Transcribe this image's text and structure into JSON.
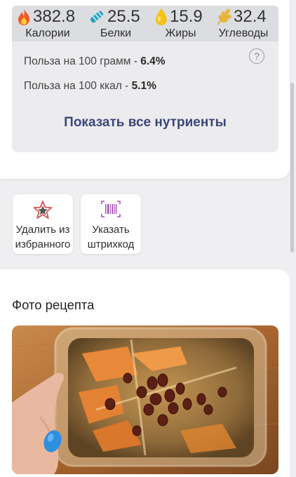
{
  "macros": [
    {
      "value": "382.8",
      "label": "Калории",
      "icon": "flame-icon",
      "color": "#f15a24"
    },
    {
      "value": "25.5",
      "label": "Белки",
      "icon": "protein-icon",
      "color": "#1e9fc1"
    },
    {
      "value": "15.9",
      "label": "Жиры",
      "icon": "fat-drop-icon",
      "color": "#f2c315"
    },
    {
      "value": "32.4",
      "label": "Углеводы",
      "icon": "wheat-icon",
      "color": "#e8b53b"
    }
  ],
  "benefit": {
    "per100g_label": "Польза на 100 грамм - ",
    "per100g_value": "6.4%",
    "per100kcal_label": "Польза на 100 ккал - ",
    "per100kcal_value": "5.1%",
    "help_glyph": "?",
    "show_all": "Показать все нутриенты"
  },
  "actions": {
    "favorite_label": "Удалить из избранного",
    "barcode_label": "Указать штрихкод"
  },
  "photo_section": {
    "title": "Фото рецепта"
  },
  "colors": {
    "accent": "#3b4778",
    "favorite_icon": "#d9534f",
    "barcode_icon": "#a64fb8"
  }
}
